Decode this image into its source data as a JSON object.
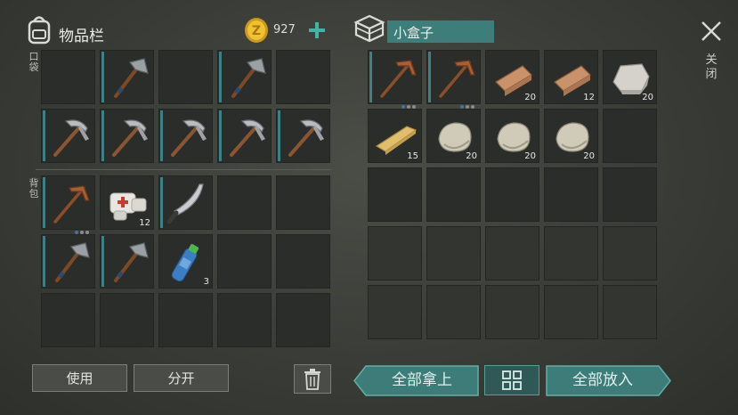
{
  "inventory": {
    "title": "物品栏",
    "coins": "927",
    "pocket_label": "口袋",
    "backpack_label": "背包"
  },
  "container": {
    "title": "小盒子"
  },
  "close_label": "关闭",
  "buttons": {
    "use": "使用",
    "split": "分开",
    "take_all": "全部拿上",
    "put_all": "全部放入"
  },
  "pocket_slots": [
    {
      "item": "empty"
    },
    {
      "item": "hatchet-icon",
      "bar": true
    },
    {
      "item": "empty"
    },
    {
      "item": "hatchet-icon",
      "bar": true
    },
    {
      "item": "empty"
    },
    {
      "item": "pickaxe-icon",
      "bar": true
    },
    {
      "item": "pickaxe-icon",
      "bar": true
    },
    {
      "item": "pickaxe-icon",
      "bar": true
    },
    {
      "item": "pickaxe-icon",
      "bar": true
    },
    {
      "item": "pickaxe-icon",
      "bar": true
    }
  ],
  "backpack_slots": [
    {
      "item": "crude-pickaxe-icon",
      "bar": true,
      "dots": true
    },
    {
      "item": "bandage-icon",
      "count": "12"
    },
    {
      "item": "machete-icon",
      "bar": true
    },
    {
      "item": "empty"
    },
    {
      "item": "empty"
    },
    {
      "item": "hatchet-icon",
      "bar": true
    },
    {
      "item": "hatchet-icon",
      "bar": true
    },
    {
      "item": "water-bottle-icon",
      "count": "3"
    },
    {
      "item": "empty"
    },
    {
      "item": "empty"
    },
    {
      "item": "empty"
    },
    {
      "item": "empty"
    },
    {
      "item": "empty"
    },
    {
      "item": "empty"
    },
    {
      "item": "empty"
    }
  ],
  "box_slots": [
    {
      "item": "crude-pickaxe-icon",
      "bar": true,
      "dots": true
    },
    {
      "item": "crude-pickaxe-icon",
      "bar": true,
      "dots": true
    },
    {
      "item": "log-icon",
      "count": "20"
    },
    {
      "item": "log-icon",
      "count": "12"
    },
    {
      "item": "limestone-icon",
      "count": "20"
    },
    {
      "item": "plank-icon",
      "count": "15"
    },
    {
      "item": "stone-icon",
      "count": "20"
    },
    {
      "item": "stone-icon",
      "count": "20"
    },
    {
      "item": "stone-icon",
      "count": "20"
    },
    {
      "item": "empty"
    }
  ]
}
